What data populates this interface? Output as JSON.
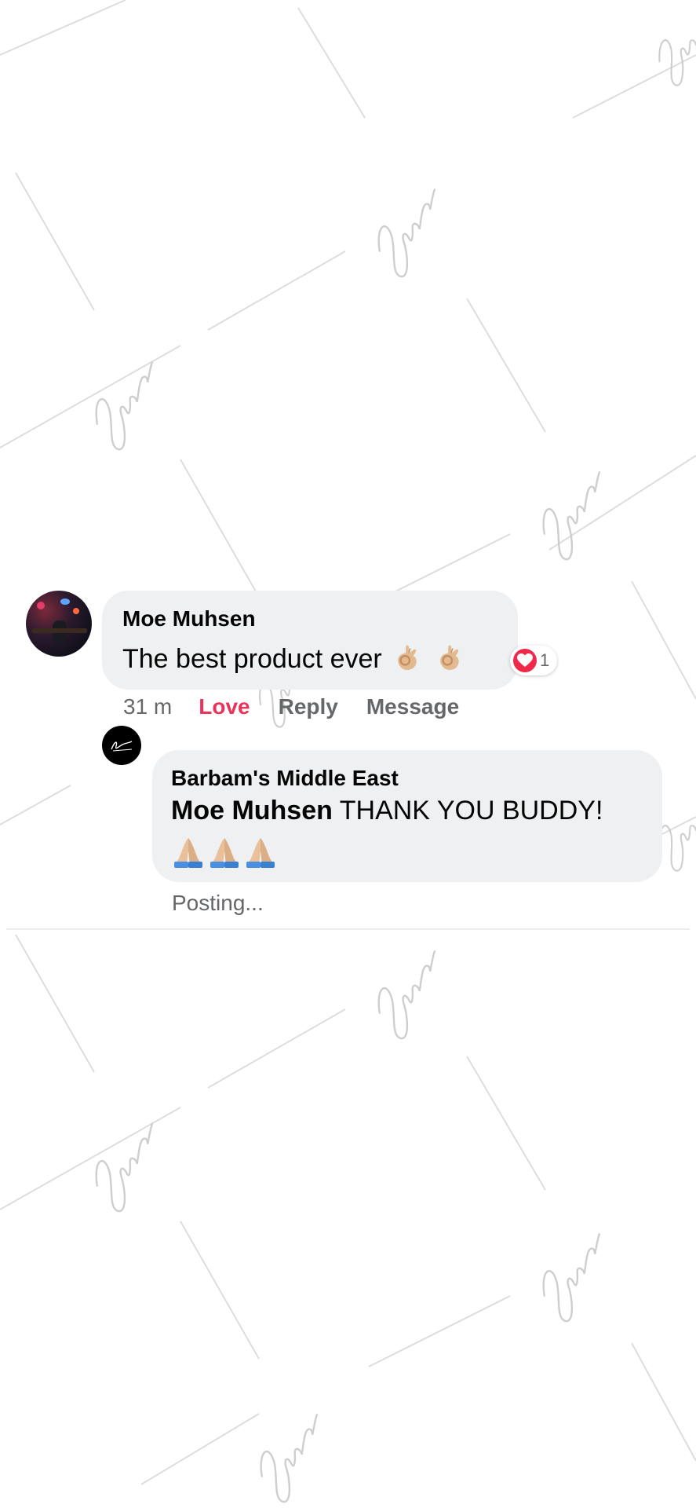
{
  "thread": {
    "comment": {
      "author": "Moe Muhsen",
      "text": "The best product ever",
      "emoji": [
        "ok-hand-emoji",
        "ok-hand-emoji"
      ],
      "reaction": {
        "icon": "heart-icon",
        "count": "1",
        "color": "#f0284a"
      },
      "time": "31 m",
      "actions": {
        "love": "Love",
        "reply": "Reply",
        "message": "Message"
      }
    },
    "reply": {
      "author": "Barbam's Middle East",
      "mention": "Moe Muhsen",
      "text": "THANK YOU BUDDY!",
      "emoji": [
        "folded-hands-emoji",
        "folded-hands-emoji",
        "folded-hands-emoji"
      ],
      "status": "Posting..."
    }
  },
  "colors": {
    "bubble": "#eff0f2",
    "love": "#e8345a",
    "secondary_text": "#65676b",
    "primary_text": "#050505"
  },
  "watermark": {
    "text": "Barbam's",
    "icon": "signature-watermark-icon"
  }
}
